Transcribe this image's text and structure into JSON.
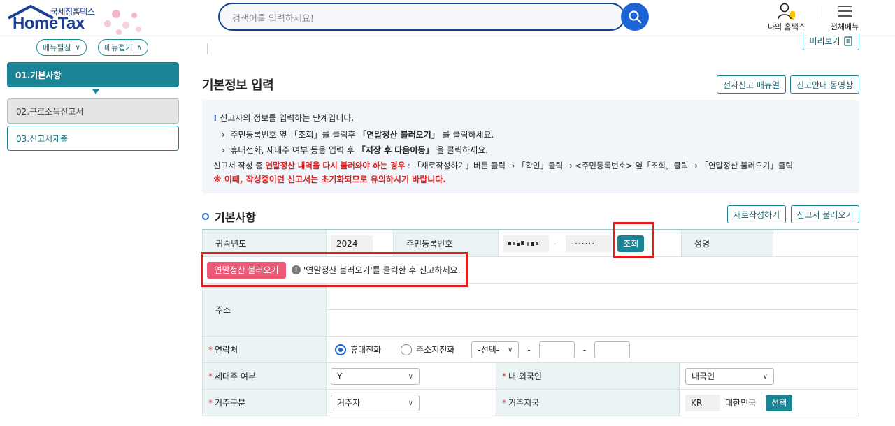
{
  "header": {
    "logo_sub": "국세청홈택스",
    "logo_main": "HomeTax",
    "search_placeholder": "검색어를 입력하세요!",
    "my_hometax": "나의 홈택스",
    "all_menu": "전체메뉴"
  },
  "sidebar": {
    "expand": "메뉴펼침",
    "collapse": "메뉴접기",
    "items": [
      {
        "label": "01.기본사항"
      },
      {
        "label": "02.근로소득신고서"
      },
      {
        "label": "03.신고서제출"
      }
    ]
  },
  "main": {
    "preview": "미리보기",
    "title": "기본정보 입력",
    "manual_btn": "전자신고 매뉴얼",
    "video_btn": "신고안내 동영상",
    "info": {
      "mark": "!",
      "line1": "신고자의 정보를 입력하는 단계입니다.",
      "line2_a": "주민등록번호 옆 「조회」를 클릭후 ",
      "line2_b": "「연말정산 불러오기」",
      "line2_c": " 를 클릭하세요.",
      "line3_a": "휴대전화, 세대주 여부 등을 입력 후 ",
      "line3_b": "「저장 후 다음이동」",
      "line3_c": " 을 클릭하세요.",
      "line4_a": "신고서 작성 중 ",
      "line4_b": "연말정산 내역을 다시 불러와야 하는 경우",
      "line4_c": " : 「새로작성하기」버튼 클릭 → 「확인」클릭 → <주민등록번호> 옆「조회」클릭 → 「연말정산 불러오기」클릭",
      "line5": "※ 이때, 작성중이던 신고서는 초기화되므로 유의하시기 바랍니다."
    },
    "section": "기본사항",
    "new_btn": "새로작성하기",
    "load_btn": "신고서 불러오기"
  },
  "form": {
    "year_label": "귀속년도",
    "year_value": "2024",
    "rrn_label": "주민등록번호",
    "rrn_sep": "-",
    "rrn_back": "·······",
    "lookup_btn": "조회",
    "name_label": "성명",
    "load_yearend_btn": "연말정산 불러오기",
    "load_hint_icon": "!",
    "load_hint": "'연말정산 불러오기'를 클릭한 후 신고하세요.",
    "address_label": "주소",
    "contact_label": "연락처",
    "radio_mobile": "휴대전화",
    "radio_home": "주소지전화",
    "phone_select": "-선택-",
    "dash": "-",
    "head_label": "세대주 여부",
    "head_value": "Y",
    "nationality_label": "내·외국인",
    "nationality_value": "내국인",
    "residence_label": "거주구분",
    "residence_value": "거주자",
    "country_label": "거주지국",
    "country_code": "KR",
    "country_name": "대한민국",
    "select_btn": "선택",
    "required_mark": "*"
  }
}
